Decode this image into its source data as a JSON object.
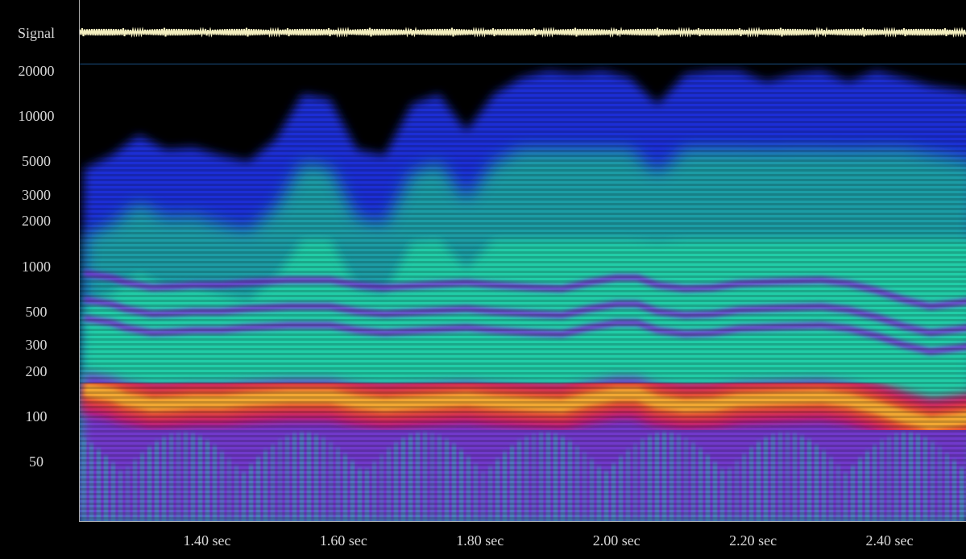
{
  "chart_data": {
    "type": "heatmap",
    "subtype": "spectrogram with signal waveform strip",
    "signal_label": "Signal",
    "y_scale": "log",
    "y_unit": "Hz",
    "y_ticks": [
      20000,
      10000,
      5000,
      3000,
      2000,
      1000,
      500,
      300,
      200,
      100,
      50
    ],
    "y_tick_labels": [
      "20000",
      "10000",
      "5000",
      "3000",
      "2000",
      "1000",
      "500",
      "300",
      "200",
      "100",
      "50"
    ],
    "ylim": [
      20,
      22000
    ],
    "x_ticks": [
      1.4,
      1.6,
      1.8,
      2.0,
      2.2,
      2.4
    ],
    "x_tick_labels": [
      "1.40 sec",
      "1.60 sec",
      "1.80 sec",
      "2.00 sec",
      "2.20 sec",
      "2.40 sec"
    ],
    "xlim": [
      1.22,
      2.53
    ],
    "colormap": [
      "#000000",
      "#1a2fd6",
      "#1aa8a0",
      "#22d6a8",
      "#7a2bd0",
      "#c8186a",
      "#e85a2a",
      "#f2a830"
    ],
    "upper_envelope_hz": [
      {
        "t": 1.22,
        "hz": 4500
      },
      {
        "t": 1.26,
        "hz": 5500
      },
      {
        "t": 1.3,
        "hz": 7500
      },
      {
        "t": 1.34,
        "hz": 6000
      },
      {
        "t": 1.38,
        "hz": 6200
      },
      {
        "t": 1.42,
        "hz": 5500
      },
      {
        "t": 1.46,
        "hz": 5000
      },
      {
        "t": 1.5,
        "hz": 7000
      },
      {
        "t": 1.54,
        "hz": 14000
      },
      {
        "t": 1.58,
        "hz": 13000
      },
      {
        "t": 1.62,
        "hz": 6000
      },
      {
        "t": 1.66,
        "hz": 5500
      },
      {
        "t": 1.7,
        "hz": 12000
      },
      {
        "t": 1.74,
        "hz": 14000
      },
      {
        "t": 1.78,
        "hz": 8000
      },
      {
        "t": 1.82,
        "hz": 14000
      },
      {
        "t": 1.86,
        "hz": 18000
      },
      {
        "t": 1.9,
        "hz": 20000
      },
      {
        "t": 1.94,
        "hz": 19000
      },
      {
        "t": 1.98,
        "hz": 20000
      },
      {
        "t": 2.02,
        "hz": 18000
      },
      {
        "t": 2.06,
        "hz": 12000
      },
      {
        "t": 2.1,
        "hz": 19000
      },
      {
        "t": 2.14,
        "hz": 20000
      },
      {
        "t": 2.18,
        "hz": 20000
      },
      {
        "t": 2.22,
        "hz": 17000
      },
      {
        "t": 2.26,
        "hz": 19000
      },
      {
        "t": 2.3,
        "hz": 20000
      },
      {
        "t": 2.34,
        "hz": 17000
      },
      {
        "t": 2.38,
        "hz": 20000
      },
      {
        "t": 2.42,
        "hz": 18000
      },
      {
        "t": 2.46,
        "hz": 16000
      },
      {
        "t": 2.5,
        "hz": 15000
      },
      {
        "t": 2.53,
        "hz": 14000
      }
    ],
    "fundamental_track_hz": [
      {
        "t": 1.22,
        "hz": 150
      },
      {
        "t": 1.26,
        "hz": 140
      },
      {
        "t": 1.28,
        "hz": 130
      },
      {
        "t": 1.32,
        "hz": 120
      },
      {
        "t": 1.35,
        "hz": 122
      },
      {
        "t": 1.38,
        "hz": 125
      },
      {
        "t": 1.42,
        "hz": 125
      },
      {
        "t": 1.46,
        "hz": 130
      },
      {
        "t": 1.52,
        "hz": 135
      },
      {
        "t": 1.58,
        "hz": 135
      },
      {
        "t": 1.62,
        "hz": 125
      },
      {
        "t": 1.66,
        "hz": 120
      },
      {
        "t": 1.72,
        "hz": 125
      },
      {
        "t": 1.78,
        "hz": 130
      },
      {
        "t": 1.82,
        "hz": 125
      },
      {
        "t": 1.88,
        "hz": 120
      },
      {
        "t": 1.92,
        "hz": 118
      },
      {
        "t": 1.96,
        "hz": 130
      },
      {
        "t": 2.0,
        "hz": 140
      },
      {
        "t": 2.03,
        "hz": 140
      },
      {
        "t": 2.06,
        "hz": 125
      },
      {
        "t": 2.1,
        "hz": 118
      },
      {
        "t": 2.14,
        "hz": 120
      },
      {
        "t": 2.18,
        "hz": 128
      },
      {
        "t": 2.24,
        "hz": 132
      },
      {
        "t": 2.3,
        "hz": 135
      },
      {
        "t": 2.34,
        "hz": 128
      },
      {
        "t": 2.38,
        "hz": 115
      },
      {
        "t": 2.42,
        "hz": 100
      },
      {
        "t": 2.46,
        "hz": 90
      },
      {
        "t": 2.5,
        "hz": 95
      },
      {
        "t": 2.53,
        "hz": 100
      }
    ],
    "legend": "none",
    "grid": false
  }
}
